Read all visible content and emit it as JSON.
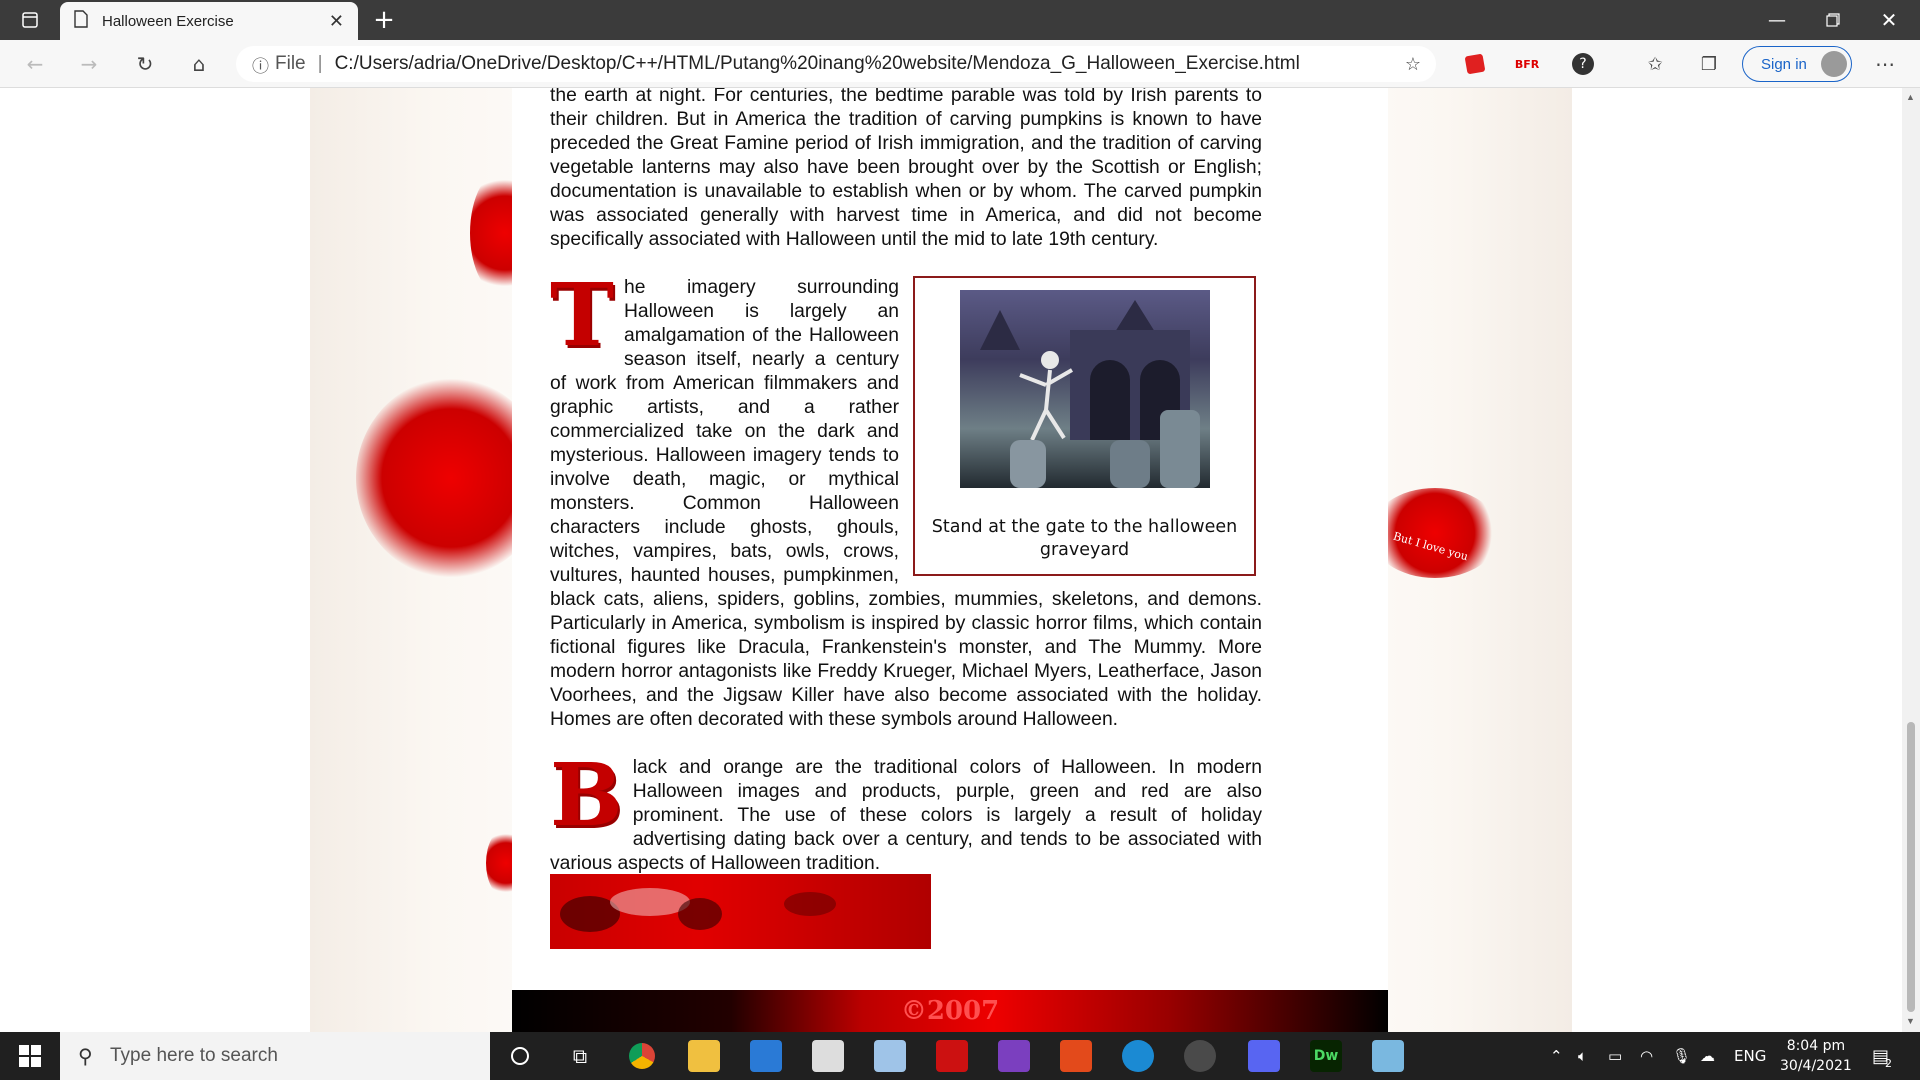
{
  "browser": {
    "tab_title": "Halloween Exercise",
    "address_file_label": "File",
    "address_url": "C:/Users/adria/OneDrive/Desktop/C++/HTML/Putang%20inang%20website/Mendoza_G_Halloween_Exercise.html",
    "signin_label": "Sign in",
    "ext_label_bfr": "BFR"
  },
  "page": {
    "para1": "the earth at night. For centuries, the bedtime parable was told by Irish parents to their children. But in America the tradition of carving pumpkins is known to have preceded the Great Famine period of Irish immigration, and the tradition of carving vegetable lanterns may also have been brought over by the Scottish or English; documentation is unavailable to establish when or by whom. The carved pumpkin was associated generally with harvest time in America, and did not become specifically associated with Halloween until the mid to late 19th century.",
    "para2_dropcap": "T",
    "para2": "he imagery surrounding Halloween is largely an amalgamation of the Halloween season itself, nearly a century of work from American filmmakers and graphic artists, and a rather commercialized take on the dark and mysterious. Halloween imagery tends to involve death, magic, or mythical monsters. Common Halloween characters include ghosts, ghouls, witches, vampires, bats, owls, crows, vultures, haunted houses, pumpkinmen, black cats, aliens, spiders, goblins, zombies, mummies, skeletons, and demons. Particularly in America, symbolism is inspired by classic horror films, which contain fictional figures like Dracula, Frankenstein's monster, and The Mummy. More modern horror antagonists like Freddy Krueger, Michael Myers, Leatherface, Jason Voorhees, and the Jigsaw Killer have also become associated with the holiday. Homes are often decorated with these symbols around Halloween.",
    "figure_caption": "Stand at the gate to the halloween graveyard",
    "para3_dropcap": "B",
    "para3": "lack and orange are the traditional colors of Halloween. In modern Halloween images and products, purple, green and red are also prominent. The use of these colors is largely a result of holiday advertising dating back over a century, and tends to be associated with various aspects of Halloween tradition.",
    "footer_text": "©2007",
    "side_note": "But I love you"
  },
  "taskbar": {
    "search_placeholder": "Type here to search",
    "language": "ENG",
    "time": "8:04 pm",
    "date": "30/4/2021",
    "notification_count": "2",
    "dw_label": "Dw"
  },
  "colors": {
    "accent": "#c40000",
    "signin": "#1a64c8",
    "taskbar": "#202020"
  }
}
